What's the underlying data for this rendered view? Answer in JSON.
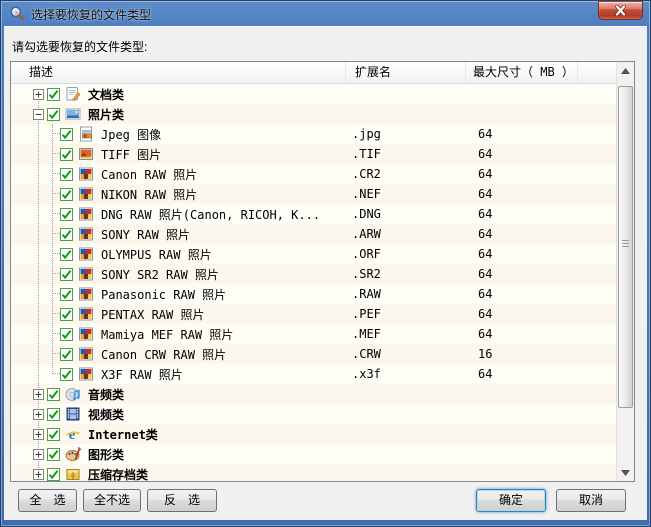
{
  "window": {
    "title": "选择要恢复的文件类型"
  },
  "prompt": "请勾选要恢复的文件类型:",
  "table": {
    "columns": [
      "描述",
      "扩展名",
      "最大尺寸（ MB ）"
    ]
  },
  "rows": [
    {
      "level": 0,
      "expander": "+",
      "checked": true,
      "icon": "document-category-icon",
      "label": "文档类",
      "ext": "",
      "size": ""
    },
    {
      "level": 0,
      "expander": "-",
      "checked": true,
      "icon": "photo-category-icon",
      "label": "照片类",
      "ext": "",
      "size": ""
    },
    {
      "level": 1,
      "checked": true,
      "icon": "jpeg-file-icon",
      "label": "Jpeg 图像",
      "ext": ".jpg",
      "size": "64"
    },
    {
      "level": 1,
      "checked": true,
      "icon": "tiff-file-icon",
      "label": "TIFF 图片",
      "ext": ".TIF",
      "size": "64"
    },
    {
      "level": 1,
      "checked": true,
      "icon": "raw-photo-file-icon",
      "label": "Canon RAW 照片",
      "ext": ".CR2",
      "size": "64"
    },
    {
      "level": 1,
      "checked": true,
      "icon": "raw-photo-file-icon",
      "label": "NIKON RAW 照片",
      "ext": ".NEF",
      "size": "64"
    },
    {
      "level": 1,
      "checked": true,
      "icon": "raw-photo-file-icon",
      "label": "DNG RAW 照片(Canon, RICOH, K...",
      "ext": ".DNG",
      "size": "64"
    },
    {
      "level": 1,
      "checked": true,
      "icon": "raw-photo-file-icon",
      "label": "SONY RAW 照片",
      "ext": ".ARW",
      "size": "64"
    },
    {
      "level": 1,
      "checked": true,
      "icon": "raw-photo-file-icon",
      "label": "OLYMPUS RAW 照片",
      "ext": ".ORF",
      "size": "64"
    },
    {
      "level": 1,
      "checked": true,
      "icon": "raw-photo-file-icon",
      "label": "SONY SR2 RAW 照片",
      "ext": ".SR2",
      "size": "64"
    },
    {
      "level": 1,
      "checked": true,
      "icon": "raw-photo-file-icon",
      "label": "Panasonic RAW 照片",
      "ext": ".RAW",
      "size": "64"
    },
    {
      "level": 1,
      "checked": true,
      "icon": "raw-photo-file-icon",
      "label": "PENTAX RAW 照片",
      "ext": ".PEF",
      "size": "64"
    },
    {
      "level": 1,
      "checked": true,
      "icon": "raw-photo-file-icon",
      "label": "Mamiya MEF RAW 照片",
      "ext": ".MEF",
      "size": "64"
    },
    {
      "level": 1,
      "checked": true,
      "icon": "raw-photo-file-icon",
      "label": "Canon CRW RAW 照片",
      "ext": ".CRW",
      "size": "16"
    },
    {
      "level": 1,
      "checked": true,
      "icon": "raw-photo-file-icon",
      "label": "X3F RAW 照片",
      "ext": ".x3f",
      "size": "64"
    },
    {
      "level": 0,
      "expander": "+",
      "checked": true,
      "icon": "audio-category-icon",
      "label": "音频类",
      "ext": "",
      "size": ""
    },
    {
      "level": 0,
      "expander": "+",
      "checked": true,
      "icon": "video-category-icon",
      "label": "视频类",
      "ext": "",
      "size": ""
    },
    {
      "level": 0,
      "expander": "+",
      "checked": true,
      "icon": "internet-category-icon",
      "label": "Internet类",
      "ext": "",
      "size": ""
    },
    {
      "level": 0,
      "expander": "+",
      "checked": true,
      "icon": "graphics-category-icon",
      "label": "图形类",
      "ext": "",
      "size": ""
    },
    {
      "level": 0,
      "expander": "+",
      "checked": true,
      "icon": "archive-category-icon",
      "label": "压缩存档类",
      "ext": "",
      "size": ""
    }
  ],
  "buttons": {
    "select_all": "全　选",
    "select_none": "全不选",
    "invert": "反　选",
    "ok": "确定",
    "cancel": "取消"
  },
  "colors": {
    "titlebar_blue": "#4E7FC1",
    "list_background": "#FFFEF6",
    "checkbox_green": "#12A012",
    "close_button_red": "#C04E39"
  }
}
